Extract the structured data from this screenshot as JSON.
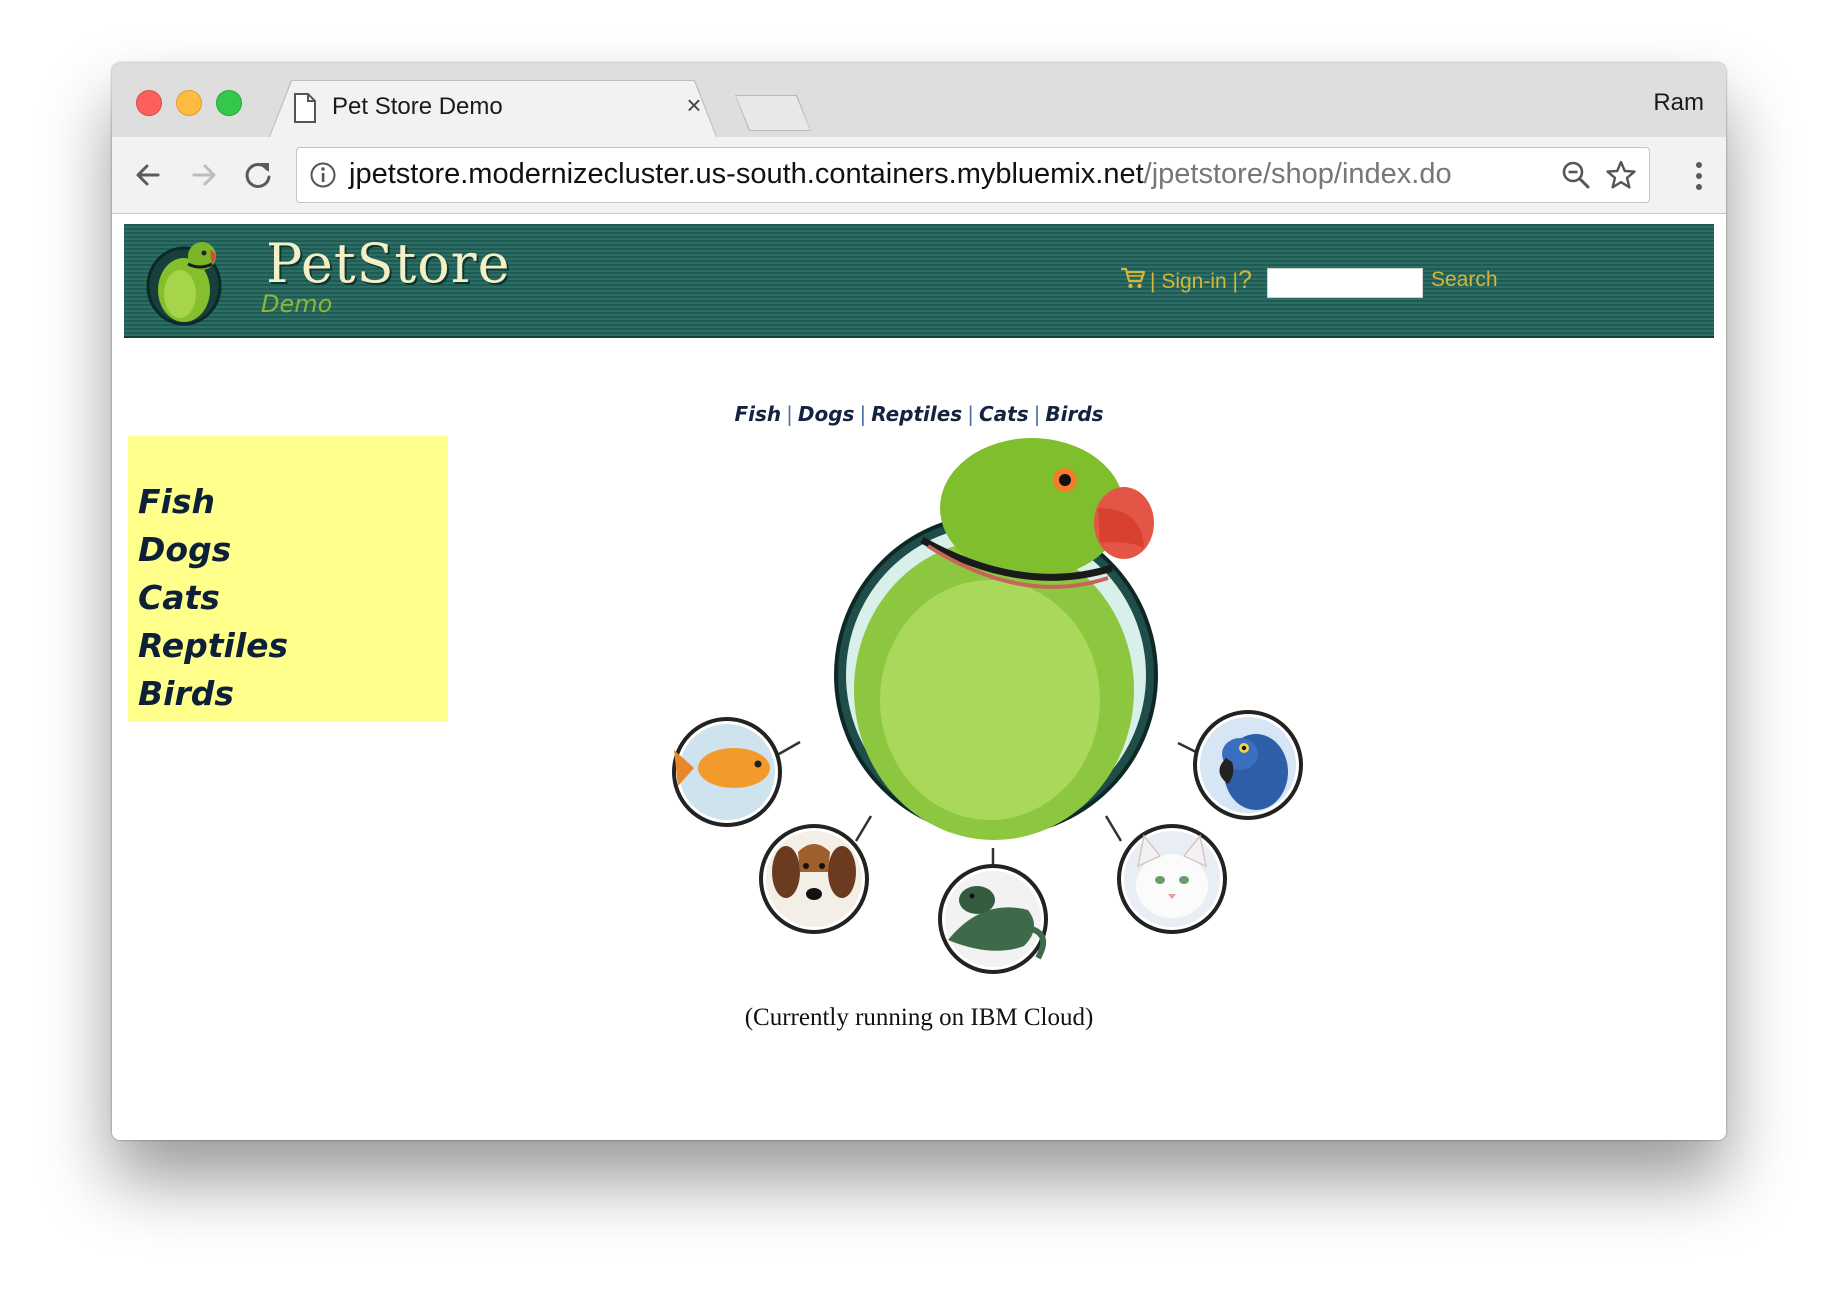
{
  "browser": {
    "tab_title": "Pet Store Demo",
    "tab_close": "×",
    "profile": "Ram",
    "url_host": "jpetstore.modernizecluster.us-south.containers.mybluemix.net",
    "url_path": "/jpetstore/shop/index.do",
    "icons": {
      "back": "arrow-left-icon",
      "forward": "arrow-right-icon",
      "reload": "reload-icon",
      "info": "info-icon",
      "zoom": "zoom-icon",
      "bookmark": "star-icon",
      "menu": "kebab-menu-icon"
    }
  },
  "header": {
    "brand_title": "PetStore",
    "brand_subtitle": "Demo",
    "sep1": "|",
    "signin_label": "Sign-in",
    "sep2": "|",
    "help_label": "?",
    "search_value": "",
    "search_label": "Search",
    "colors": {
      "banner": "#1f5a53",
      "link": "#d6b63a",
      "subtitle": "#8bb830"
    }
  },
  "quick_nav": {
    "items": [
      "Fish",
      "Dogs",
      "Reptiles",
      "Cats",
      "Birds"
    ],
    "separator": "|"
  },
  "sidebar": {
    "background": "#ffff8c",
    "items": [
      "Fish",
      "Dogs",
      "Cats",
      "Reptiles",
      "Birds"
    ]
  },
  "main": {
    "image_map_icon": "parrot-pet-map-icon",
    "note": "(Currently running on IBM Cloud)"
  }
}
